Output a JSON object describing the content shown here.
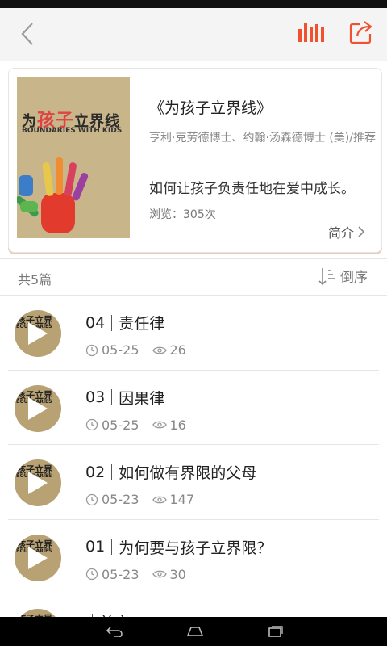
{
  "header": {
    "back_icon": "chevron-left-icon",
    "chart_icon": "audio-bars-icon",
    "share_icon": "share-icon",
    "accent": "#f0522f"
  },
  "book": {
    "cover_title_a": "为",
    "cover_title_b": "孩子",
    "cover_title_c": "立界线",
    "cover_subtitle": "BOUNDARIES WITH KIDS",
    "title": "《为孩子立界线》",
    "author": "亨利·克劳德博士、约翰·汤森德博士 (美)/推荐",
    "description": "如何让孩子负责任地在爱中成长。",
    "views": "浏览：305次",
    "intro_label": "简介"
  },
  "list_header": {
    "count": "共5篇",
    "sort_label": "倒序"
  },
  "episodes": [
    {
      "num": "04",
      "title": "责任律",
      "date": "05-25",
      "plays": "26"
    },
    {
      "num": "03",
      "title": "因果律",
      "date": "05-25",
      "plays": "16"
    },
    {
      "num": "02",
      "title": "如何做有界限的父母",
      "date": "05-23",
      "plays": "147"
    },
    {
      "num": "01",
      "title": "为何要与孩子立界限？",
      "date": "05-23",
      "plays": "30"
    },
    {
      "num": "",
      "title": "前言",
      "date": "",
      "plays": ""
    }
  ],
  "thumb": {
    "t1": "孩子立界",
    "t2": "BOUNDARIES"
  }
}
